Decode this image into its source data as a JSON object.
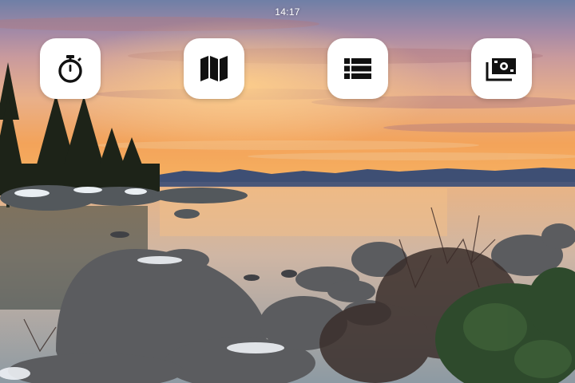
{
  "status_bar": {
    "time": "14:17"
  },
  "home_buttons": [
    {
      "icon": "stopwatch-icon"
    },
    {
      "icon": "map-icon"
    },
    {
      "icon": "list-icon"
    },
    {
      "icon": "money-icon"
    }
  ],
  "colors": {
    "button_bg": "#ffffff",
    "icon": "#111111"
  }
}
